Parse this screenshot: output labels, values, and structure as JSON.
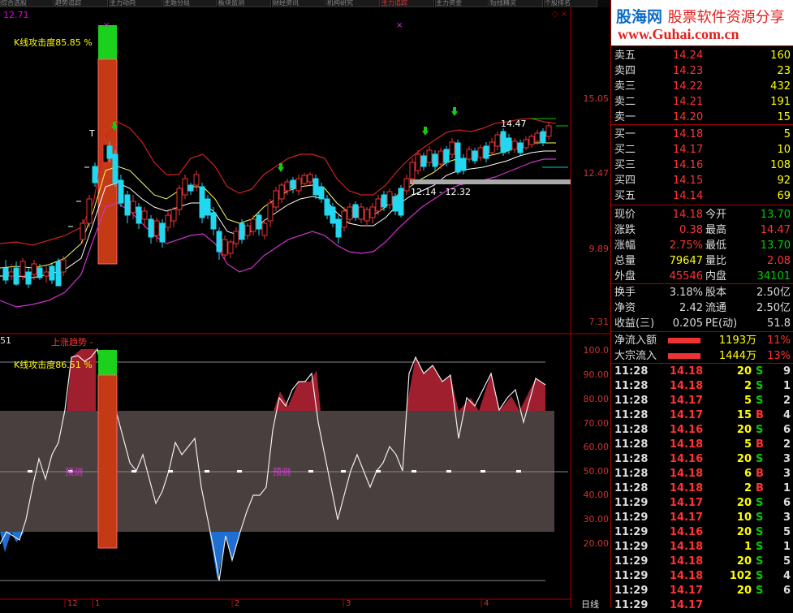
{
  "toolbar": {
    "tabs": [
      "综合选股",
      "趋势追踪",
      "主力动向",
      "主题分组",
      "板块监测",
      "财经资讯",
      "机构研究",
      "主力追踪",
      "主力资金",
      "短线精灵",
      "个股排名"
    ]
  },
  "chart": {
    "price_top_label": "12.71",
    "indicator1_label": "K线攻击度85.85 %",
    "indicator2_label": "K线攻击度86.51 %",
    "trend_label": "上涨趋势 -",
    "sub_left_label": "51",
    "forecast_label_1": "预测",
    "forecast_label_2": "预测",
    "peak_label": "14.47",
    "range_label": "12.14 - 12.32",
    "marker_t": "T",
    "price_axis": [
      "15.05",
      "12.47",
      "9.89",
      "7.31"
    ],
    "osc_axis": [
      "100.0",
      "90.00",
      "80.00",
      "70.00",
      "60.00",
      "50.00",
      "40.00",
      "30.00",
      "20.00"
    ],
    "date_axis": [
      "12",
      "1",
      "2",
      "3",
      "4"
    ],
    "period_label": "日线"
  },
  "quote": {
    "logo_line1_a": "股海网",
    "logo_line1_b": "股票软件资源分享",
    "logo_line2": "www.Guhai.com.cn",
    "asks": [
      {
        "label": "卖五",
        "price": "14.24",
        "vol": "160"
      },
      {
        "label": "卖四",
        "price": "14.23",
        "vol": "23"
      },
      {
        "label": "卖三",
        "price": "14.22",
        "vol": "432"
      },
      {
        "label": "卖二",
        "price": "14.21",
        "vol": "191"
      },
      {
        "label": "卖一",
        "price": "14.20",
        "vol": "15"
      }
    ],
    "bids": [
      {
        "label": "买一",
        "price": "14.18",
        "vol": "5"
      },
      {
        "label": "买二",
        "price": "14.17",
        "vol": "10"
      },
      {
        "label": "买三",
        "price": "14.16",
        "vol": "108"
      },
      {
        "label": "买四",
        "price": "14.15",
        "vol": "92"
      },
      {
        "label": "买五",
        "price": "14.14",
        "vol": "69"
      }
    ],
    "stats": [
      {
        "l1": "现价",
        "v1": "14.18",
        "c1": "r",
        "l2": "今开",
        "v2": "13.70",
        "c2": "g"
      },
      {
        "l1": "涨跌",
        "v1": "0.38",
        "c1": "r",
        "l2": "最高",
        "v2": "14.47",
        "c2": "r"
      },
      {
        "l1": "涨幅",
        "v1": "2.75%",
        "c1": "r",
        "l2": "最低",
        "v2": "13.70",
        "c2": "g"
      },
      {
        "l1": "总量",
        "v1": "79647",
        "c1": "y",
        "l2": "量比",
        "v2": "2.08",
        "c2": "r"
      },
      {
        "l1": "外盘",
        "v1": "45546",
        "c1": "r",
        "l2": "内盘",
        "v2": "34101",
        "c2": "g"
      }
    ],
    "stats2": [
      {
        "l1": "换手",
        "v1": "3.18%",
        "l2": "股本",
        "v2": "2.50亿"
      },
      {
        "l1": "净资",
        "v1": "2.42",
        "l2": "流通",
        "v2": "2.50亿"
      },
      {
        "l1": "收益(三)",
        "v1": "0.205",
        "l2": "PE(动)",
        "v2": "51.8"
      }
    ],
    "flows": [
      {
        "label": "净流入额",
        "value": "1193万",
        "pct": "11%"
      },
      {
        "label": "大宗流入",
        "value": "1444万",
        "pct": "13%"
      }
    ],
    "ticks": [
      {
        "t": "11:28",
        "p": "14.18",
        "v": "20",
        "s": "S",
        "n": "9"
      },
      {
        "t": "11:28",
        "p": "14.18",
        "v": "2",
        "s": "S",
        "n": "1"
      },
      {
        "t": "11:28",
        "p": "14.17",
        "v": "5",
        "s": "S",
        "n": "2"
      },
      {
        "t": "11:28",
        "p": "14.17",
        "v": "15",
        "s": "B",
        "n": "4"
      },
      {
        "t": "11:28",
        "p": "14.16",
        "v": "20",
        "s": "S",
        "n": "6"
      },
      {
        "t": "11:28",
        "p": "14.18",
        "v": "5",
        "s": "B",
        "n": "2"
      },
      {
        "t": "11:28",
        "p": "14.16",
        "v": "20",
        "s": "S",
        "n": "3"
      },
      {
        "t": "11:28",
        "p": "14.18",
        "v": "6",
        "s": "B",
        "n": "3"
      },
      {
        "t": "11:28",
        "p": "14.18",
        "v": "2",
        "s": "B",
        "n": "1"
      },
      {
        "t": "11:29",
        "p": "14.17",
        "v": "20",
        "s": "S",
        "n": "6"
      },
      {
        "t": "11:29",
        "p": "14.17",
        "v": "10",
        "s": "S",
        "n": "3"
      },
      {
        "t": "11:29",
        "p": "14.16",
        "v": "20",
        "s": "S",
        "n": "5"
      },
      {
        "t": "11:29",
        "p": "14.18",
        "v": "1",
        "s": "S",
        "n": "1"
      },
      {
        "t": "11:29",
        "p": "14.18",
        "v": "20",
        "s": "S",
        "n": "5"
      },
      {
        "t": "11:29",
        "p": "14.18",
        "v": "102",
        "s": "S",
        "n": "4"
      },
      {
        "t": "11:29",
        "p": "14.17",
        "v": "20",
        "s": "S",
        "n": "6"
      },
      {
        "t": "11:29",
        "p": "14.17",
        "v": "",
        "s": "",
        "n": ""
      }
    ]
  }
}
